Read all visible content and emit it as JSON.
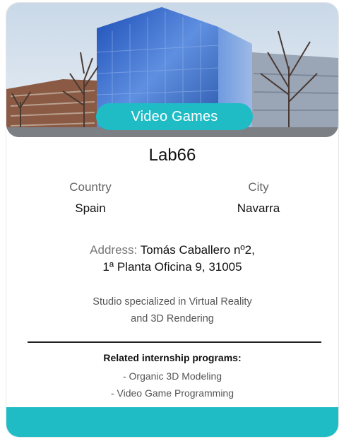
{
  "card": {
    "category": "Video Games",
    "title": "Lab66",
    "country": {
      "label": "Country",
      "value": "Spain"
    },
    "city": {
      "label": "City",
      "value": "Navarra"
    },
    "address": {
      "label": "Address:",
      "line1": "Tomás Caballero nº2,",
      "line2": "1ª Planta Oficina 9, 31005"
    },
    "description": {
      "line1": "Studio specialized in Virtual Reality",
      "line2": "and 3D Rendering"
    },
    "related": {
      "title": "Related internship programs:",
      "items": [
        "- Organic 3D Modeling",
        "- Video Game Programming"
      ]
    }
  },
  "colors": {
    "accent": "#1fbcc6",
    "text": "#111111",
    "muted": "#666666"
  }
}
